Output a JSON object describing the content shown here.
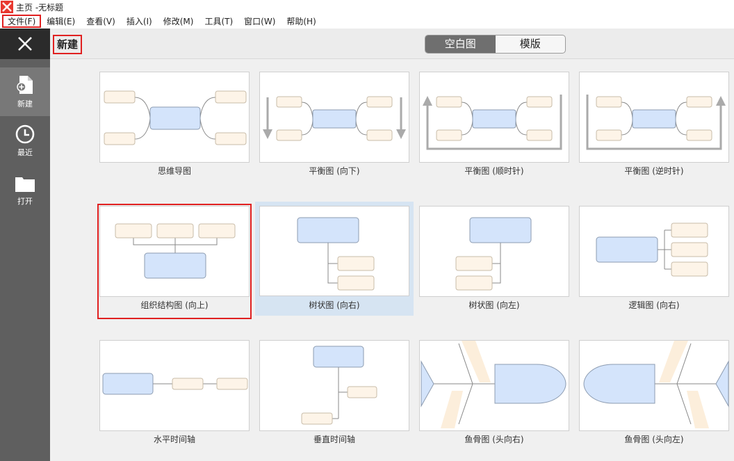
{
  "window": {
    "title": "主页 -无标题"
  },
  "menu": {
    "file": "文件(F)",
    "edit": "编辑(E)",
    "view": "查看(V)",
    "insert": "插入(I)",
    "modify": "修改(M)",
    "tools": "工具(T)",
    "window": "窗口(W)",
    "help": "帮助(H)"
  },
  "sidebar": {
    "new": "新建",
    "recent": "最近",
    "open": "打开"
  },
  "header": {
    "title": "新建",
    "toggle_blank": "空白图",
    "toggle_template": "模版"
  },
  "templates": [
    {
      "label": "思维导图"
    },
    {
      "label": "平衡图 (向下)"
    },
    {
      "label": "平衡图 (顺时针)"
    },
    {
      "label": "平衡图 (逆时针)"
    },
    {
      "label": "组织结构图 (向上)"
    },
    {
      "label": "树状图 (向右)"
    },
    {
      "label": "树状图 (向左)"
    },
    {
      "label": "逻辑图 (向右)"
    },
    {
      "label": "水平时间轴"
    },
    {
      "label": "垂直时间轴"
    },
    {
      "label": "鱼骨图 (头向右)"
    },
    {
      "label": "鱼骨图 (头向左)"
    }
  ],
  "colors": {
    "accent_red": "#e02020",
    "main_topic_fill": "#d4e4fb",
    "sub_topic_fill": "#fdf4e8",
    "sidebar_bg": "#5f5f5f"
  }
}
